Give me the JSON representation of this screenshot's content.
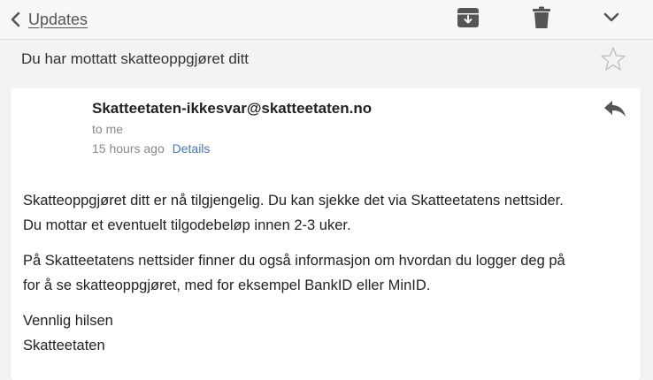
{
  "header": {
    "back_label": "Updates",
    "icons": [
      "chevron-left-icon",
      "archive-icon",
      "trash-icon",
      "chevron-down-icon"
    ]
  },
  "email": {
    "subject": "Du har mottatt skatteoppgjøret ditt",
    "sender": "Skatteetaten-ikkesvar@skatteetaten.no",
    "recipient": "to me",
    "time": "15 hours ago",
    "details_label": "Details",
    "body": {
      "p1_line1": "Skatteoppgjøret ditt er nå tilgjengelig. Du kan sjekke det via Skatteetatens nettsider.",
      "p1_line2": "Du mottar et eventuelt tilgodebeløp innen 2-3 uker.",
      "p2_line1": "På Skatteetatens nettsider finner du også informasjon om hvordan du logger deg på",
      "p2_line2": "for å se skatteoppgjøret, med for eksempel BankID eller MinID.",
      "closing": "Vennlig hilsen",
      "signature": "Skatteetaten"
    }
  },
  "colors": {
    "link": "#4a76b8",
    "icon": "#555555",
    "background": "#f3f3f3",
    "card": "#ffffff"
  }
}
